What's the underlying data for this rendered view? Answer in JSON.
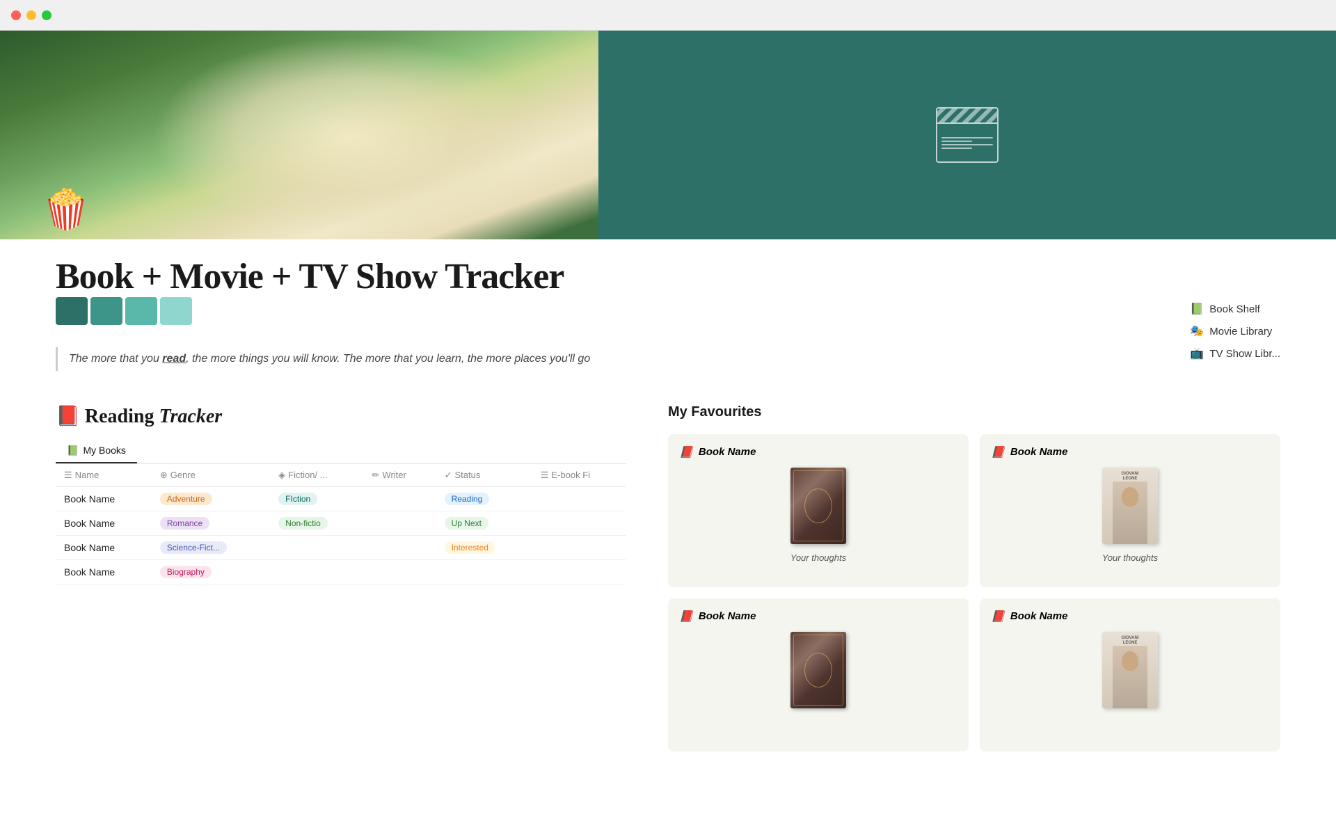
{
  "window": {
    "traffic_lights": [
      "close",
      "minimize",
      "maximize"
    ]
  },
  "page_title": "Book  + Movie + TV Show Tracker",
  "quote": {
    "prefix": "The more that you ",
    "bold_word": "read",
    "suffix": ", the more things you will know. The more that you learn, the more places you'll go"
  },
  "color_swatches": [
    "#2d7068",
    "#3d9488",
    "#5ab8aa",
    "#8ed6ce"
  ],
  "nav": {
    "items": [
      {
        "icon": "📗",
        "label": "Book Shelf"
      },
      {
        "icon": "🎭",
        "label": "Movie Library"
      },
      {
        "icon": "📺",
        "label": "TV Show Libr..."
      }
    ]
  },
  "reading_tracker": {
    "title_prefix": "📕 Reading ",
    "title_italic": "Tracker",
    "tabs": [
      {
        "icon": "📗",
        "label": "My Books",
        "active": true
      }
    ],
    "columns": [
      {
        "icon": "☰",
        "label": "Name"
      },
      {
        "icon": "⊕",
        "label": "Genre"
      },
      {
        "icon": "◈",
        "label": "Fiction/ ..."
      },
      {
        "icon": "✏",
        "label": "Writer"
      },
      {
        "icon": "✓",
        "label": "Status"
      },
      {
        "icon": "☰",
        "label": "E-book Fi"
      }
    ],
    "rows": [
      {
        "name": "Book Name",
        "genre": "Adventure",
        "genre_class": "tag-adventure",
        "fiction": "FIction",
        "fiction_class": "tag-fiction",
        "writer": "",
        "status": "Reading",
        "status_class": "tag-reading",
        "ebook": ""
      },
      {
        "name": "Book Name",
        "genre": "Romance",
        "genre_class": "tag-romance",
        "fiction": "Non-fictio",
        "fiction_class": "tag-nonfiction",
        "writer": "",
        "status": "Up Next",
        "status_class": "tag-upnext",
        "ebook": ""
      },
      {
        "name": "Book Name",
        "genre": "Science-Fict...",
        "genre_class": "tag-scifi",
        "fiction": "",
        "fiction_class": "",
        "writer": "",
        "status": "Interested",
        "status_class": "tag-interested",
        "ebook": ""
      },
      {
        "name": "Book Name",
        "genre": "Biography",
        "genre_class": "tag-biography",
        "fiction": "",
        "fiction_class": "",
        "writer": "",
        "status": "",
        "status_class": "",
        "ebook": ""
      }
    ]
  },
  "favourites": {
    "title": "My Favourites",
    "cards": [
      {
        "emoji": "📕",
        "book_name": "Book Name",
        "cover_type": "ornate",
        "thoughts": "Your thoughts"
      },
      {
        "emoji": "📕",
        "book_name": "Book Name",
        "cover_type": "portrait",
        "thoughts": "Your thoughts"
      },
      {
        "emoji": "📕",
        "book_name": "Book Name",
        "cover_type": "ornate",
        "thoughts": ""
      },
      {
        "emoji": "📕",
        "book_name": "Book Name",
        "cover_type": "portrait",
        "thoughts": ""
      }
    ]
  }
}
